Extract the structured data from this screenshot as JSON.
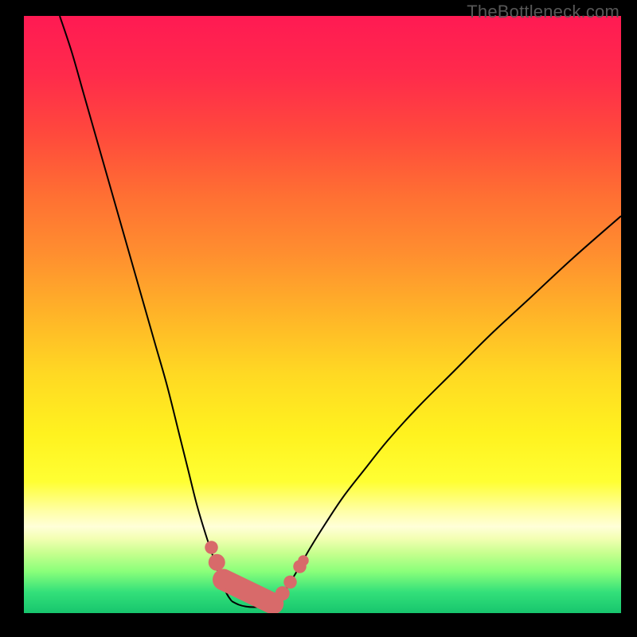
{
  "watermark": "TheBottleneck.com",
  "gradient": {
    "stops": [
      {
        "offset": 0.0,
        "color": "#ff1a53"
      },
      {
        "offset": 0.1,
        "color": "#ff2b4b"
      },
      {
        "offset": 0.2,
        "color": "#ff4a3c"
      },
      {
        "offset": 0.3,
        "color": "#ff6f33"
      },
      {
        "offset": 0.4,
        "color": "#ff8f2f"
      },
      {
        "offset": 0.5,
        "color": "#ffb428"
      },
      {
        "offset": 0.6,
        "color": "#ffd923"
      },
      {
        "offset": 0.7,
        "color": "#fff21f"
      },
      {
        "offset": 0.78,
        "color": "#ffff33"
      },
      {
        "offset": 0.83,
        "color": "#ffffa8"
      },
      {
        "offset": 0.855,
        "color": "#ffffd8"
      },
      {
        "offset": 0.875,
        "color": "#f3ffb3"
      },
      {
        "offset": 0.9,
        "color": "#c6ff8e"
      },
      {
        "offset": 0.93,
        "color": "#8aff7a"
      },
      {
        "offset": 0.965,
        "color": "#33e07a"
      },
      {
        "offset": 1.0,
        "color": "#17c56d"
      }
    ]
  },
  "chart_data": {
    "type": "line",
    "title": "",
    "xlabel": "",
    "ylabel": "",
    "xlim": [
      0,
      100
    ],
    "ylim": [
      0,
      100
    ],
    "grid": false,
    "annotations": [
      "TheBottleneck.com"
    ],
    "series": [
      {
        "name": "left-curve",
        "x": [
          6,
          8,
          10,
          12,
          14,
          16,
          18,
          20,
          22,
          24,
          26,
          27.5,
          29,
          30.5,
          32,
          33,
          34,
          34.8
        ],
        "y": [
          100,
          94,
          87,
          80,
          73,
          66,
          59,
          52,
          45,
          38,
          30,
          24,
          18,
          13,
          8.5,
          5.5,
          3.2,
          2.0
        ]
      },
      {
        "name": "right-curve",
        "x": [
          42.2,
          43.2,
          44.5,
          46,
          48,
          50.5,
          53.5,
          57,
          61,
          66,
          72,
          78,
          85,
          92,
          100
        ],
        "y": [
          2.0,
          3.0,
          5.0,
          7.5,
          11,
          15,
          19.5,
          24,
          29,
          34.5,
          40.5,
          46.5,
          53,
          59.5,
          66.5
        ]
      },
      {
        "name": "valley-bottom",
        "x": [
          34.8,
          36.0,
          37.2,
          38.5,
          40.0,
          41.2,
          42.2
        ],
        "y": [
          2.0,
          1.4,
          1.1,
          1.0,
          1.1,
          1.4,
          2.0
        ]
      }
    ],
    "markers": [
      {
        "name": "left-marker-1",
        "x": 31.4,
        "y": 11.0,
        "r": 1.1
      },
      {
        "name": "left-marker-2",
        "x": 32.3,
        "y": 8.5,
        "r": 1.4
      },
      {
        "name": "left-pill-top",
        "x": 33.4,
        "y": 5.6,
        "r": 1.6
      },
      {
        "name": "right-marker-1",
        "x": 43.3,
        "y": 3.3,
        "r": 1.2
      },
      {
        "name": "right-marker-2",
        "x": 44.6,
        "y": 5.2,
        "r": 1.1
      },
      {
        "name": "right-marker-3",
        "x": 46.2,
        "y": 7.8,
        "r": 1.1
      },
      {
        "name": "right-marker-4",
        "x": 46.8,
        "y": 8.8,
        "r": 0.9
      }
    ],
    "bottom_pill": {
      "x1": 33.4,
      "y1": 5.6,
      "x2": 41.7,
      "y2": 1.6,
      "width": 3.6
    },
    "marker_color": "#d86a6a",
    "curve_color": "#000000"
  }
}
